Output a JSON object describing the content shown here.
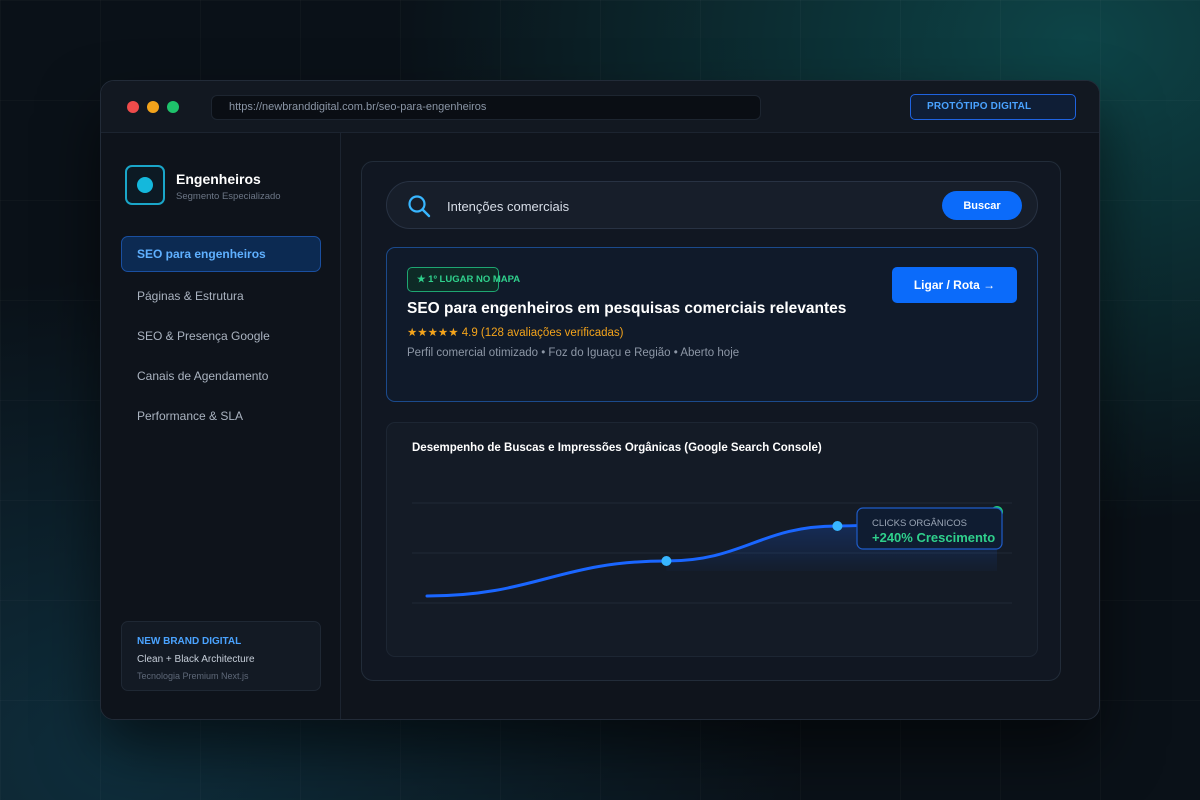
{
  "browser": {
    "url": "https://newbranddigital.com.br/seo-para-engenheiros",
    "badge": "PROTÓTIPO DIGITAL"
  },
  "sidebar": {
    "brand_name": "Engenheiros",
    "brand_subtitle": "Segmento Especializado",
    "items": [
      {
        "label": "SEO para engenheiros",
        "active": true
      },
      {
        "label": "Páginas & Estrutura",
        "active": false
      },
      {
        "label": "SEO & Presença Google",
        "active": false
      },
      {
        "label": "Canais de Agendamento",
        "active": false
      },
      {
        "label": "Performance & SLA",
        "active": false
      }
    ],
    "card": {
      "title": "NEW BRAND DIGITAL",
      "line1": "Clean + Black Architecture",
      "line2": "Tecnologia Premium Next.js"
    }
  },
  "search": {
    "value": "Intenções comerciais",
    "button_label": "Buscar",
    "icon": "search-icon"
  },
  "listing": {
    "badge": "★ 1º LUGAR NO MAPA",
    "title": "SEO para engenheiros em pesquisas comerciais relevantes",
    "rating": "★★★★★ 4.9 (128 avaliações verificadas)",
    "meta": "Perfil comercial otimizado • Foz do Iguaçu e Região • Aberto hoje",
    "cta_label": "Ligar / Rota →"
  },
  "chart": {
    "title": "Desempenho de Buscas e Impressões Orgânicas (Google Search Console)",
    "callout_label": "CLICKS ORGÂNICOS",
    "callout_value": "+240% Crescimento"
  },
  "chart_data": {
    "type": "line",
    "title": "Desempenho de Buscas e Impressões Orgânicas (Google Search Console)",
    "xlabel": "",
    "ylabel": "",
    "grid": true,
    "ylim": [
      0,
      3
    ],
    "series": [
      {
        "values": [
          0.2,
          1.2,
          2.2,
          2.6
        ]
      }
    ],
    "x": [
      0,
      0.42,
      0.72,
      1.0
    ],
    "marked_points": [
      1,
      2,
      3
    ],
    "annotation": "CLICKS ORGÂNICOS +240% Crescimento",
    "colors": {
      "line": "#1a66ff",
      "point": "#38b6ff",
      "end_point": "#1fc97a",
      "callout_value": "#2fd08c"
    }
  },
  "colors": {
    "accent": "#0b6bfa",
    "link": "#4aa3ff",
    "success": "#2fd08c",
    "star": "#f3a31b"
  }
}
